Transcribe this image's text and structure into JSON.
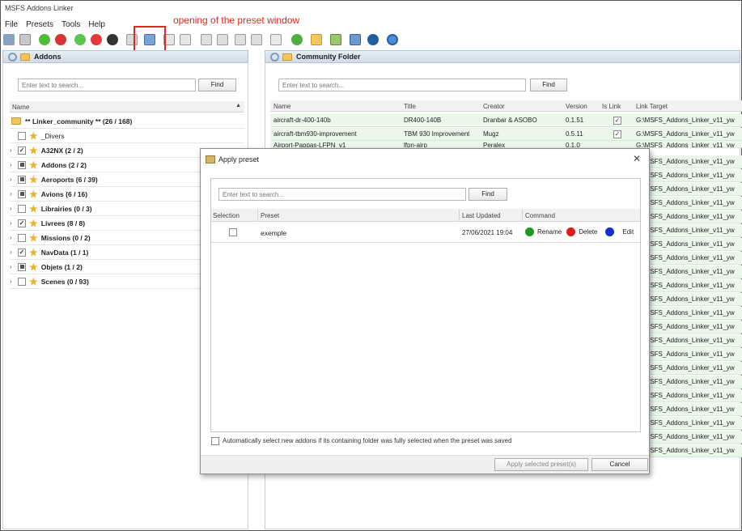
{
  "window": {
    "title": "MSFS Addons Linker"
  },
  "annotation": {
    "text": "opening of the preset window",
    "color": "#e0281e"
  },
  "menu": [
    "File",
    "Presets",
    "Tools",
    "Help"
  ],
  "toolbar_icons": [
    "open-icon",
    "copy-icon",
    "check-green-icon",
    "close-red-icon",
    "circle-green-icon",
    "circle-red-icon",
    "circle-black-icon",
    "list-icon",
    "apply-preset-icon",
    "preset-add-icon",
    "preset-remove-icon",
    "link-icon",
    "link-left-icon",
    "link-right-icon",
    "unlink-icon",
    "tree-icon",
    "refresh-icon",
    "folder-icon",
    "image-icon",
    "window-icon",
    "globe-icon",
    "settings-icon"
  ],
  "addons_panel": {
    "title": "Addons",
    "search_placeholder": "Enter text to search...",
    "find_label": "Find",
    "column_name": "Name",
    "root": "** Linker_community ** (26 / 168)",
    "items": [
      {
        "label": "_Divers",
        "state": "empty",
        "expander": false,
        "bold": false
      },
      {
        "label": "A32NX (2 / 2)",
        "state": "checked",
        "expander": true,
        "bold": true
      },
      {
        "label": "Addons (2 / 2)",
        "state": "partial",
        "expander": true,
        "bold": true
      },
      {
        "label": "Aeroports (6 / 39)",
        "state": "partial",
        "expander": true,
        "bold": true
      },
      {
        "label": "Avions (6 / 16)",
        "state": "partial",
        "expander": true,
        "bold": true
      },
      {
        "label": "Librairies (0 / 3)",
        "state": "empty",
        "expander": true,
        "bold": true
      },
      {
        "label": "Livrees (8 / 8)",
        "state": "checked",
        "expander": true,
        "bold": true
      },
      {
        "label": "Missions (0 / 2)",
        "state": "empty",
        "expander": true,
        "bold": true
      },
      {
        "label": "NavData (1 / 1)",
        "state": "checked",
        "expander": true,
        "bold": true
      },
      {
        "label": "Objets (1 / 2)",
        "state": "partial",
        "expander": true,
        "bold": true
      },
      {
        "label": "Scenes (0 / 93)",
        "state": "empty",
        "expander": true,
        "bold": true
      }
    ]
  },
  "community_panel": {
    "title": "Community Folder",
    "search_placeholder": "Enter text to search...",
    "find_label": "Find",
    "columns": [
      "Name",
      "Title",
      "Creator",
      "Version",
      "Is Link",
      "Link Target"
    ],
    "rows": [
      {
        "name": "aircraft-dr-400-140b",
        "title": "DR400-140B",
        "creator": "Dranbar & ASOBO",
        "version": "0.1.51",
        "is_link": true,
        "target": "G:\\MSFS_Addons_Linker_v11_yw"
      },
      {
        "name": "aircraft-tbm930-improvement",
        "title": "TBM 930 Improvement",
        "creator": "Mugz",
        "version": "0.5.11",
        "is_link": true,
        "target": "G:\\MSFS_Addons_Linker_v11_yw"
      }
    ],
    "partial_row": {
      "name": "Airport-Pappas-LFPN_v1",
      "title": "lfpn-airp",
      "creator": "Peralex",
      "version": "0.1.0",
      "target": "G:\\MSFS_Addons_Linker_v11_yw"
    },
    "hidden_rows_target": "G:\\MSFS_Addons_Linker_v11_yw",
    "hidden_rows_count": 22
  },
  "dialog": {
    "title": "Apply preset",
    "search_placeholder": "Enter text to search...",
    "find_label": "Find",
    "columns": {
      "selection": "Selection",
      "preset": "Preset",
      "last_updated": "Last Updated",
      "command": "Command"
    },
    "rows": [
      {
        "preset": "exemple",
        "last_updated": "27/06/2021 19:04",
        "rename": "Rename",
        "delete": "Delete",
        "edit": "Edit"
      }
    ],
    "auto_select_label": "Automatically select new addons if its containing folder was fully selected when the preset was saved",
    "apply_label": "Apply selected preset(s)",
    "cancel_label": "Cancel",
    "close_glyph": "✕"
  },
  "colors": {
    "rename": "#1f9a1f",
    "delete": "#e21a1a",
    "edit": "#1530d0",
    "row_green": "#eaf7ea"
  }
}
